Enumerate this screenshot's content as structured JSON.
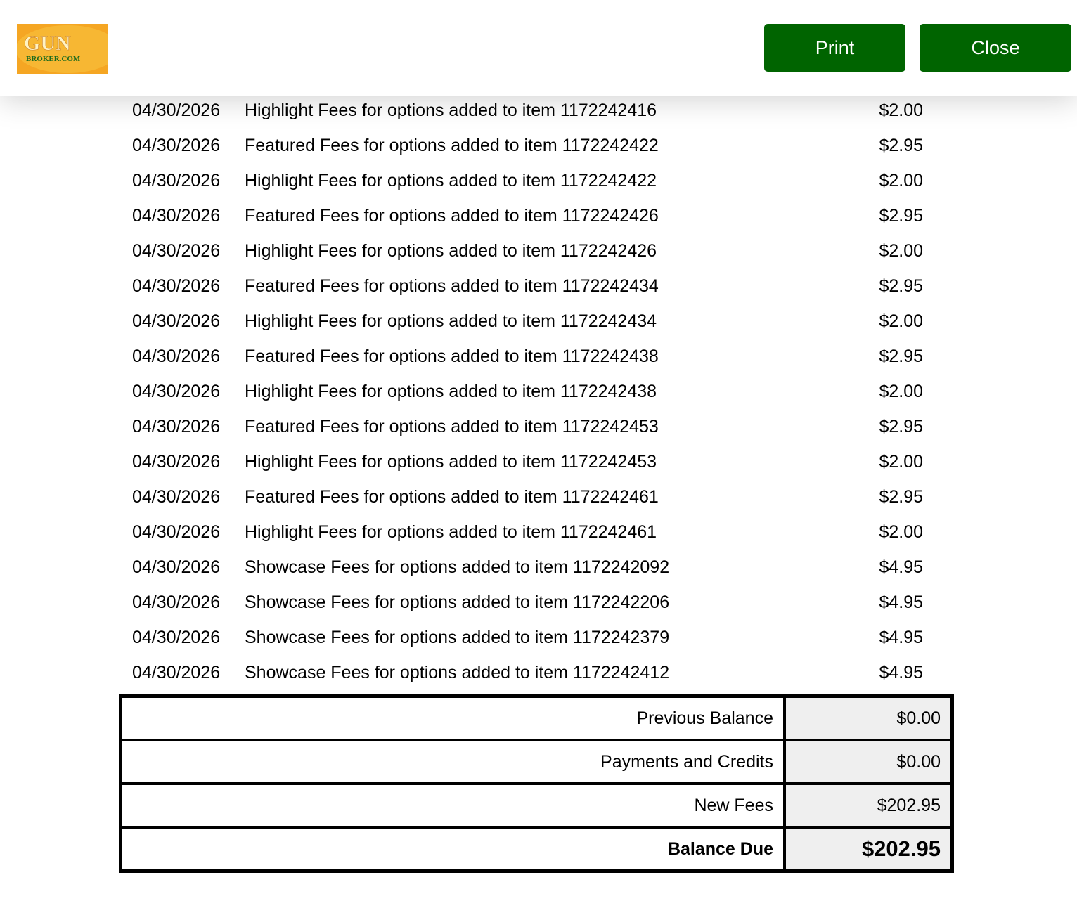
{
  "header": {
    "logo_text_top": "GUN",
    "logo_text_bottom": "BROKER.COM",
    "print_label": "Print",
    "close_label": "Close"
  },
  "colors": {
    "button_green": "#006400",
    "logo_orange": "#F5A623",
    "logo_green": "#1E6B1E",
    "summary_value_bg": "#EFEFEF"
  },
  "fees": [
    {
      "date": "04/30/2026",
      "description": "Highlight Fees for options added to item 1172242416",
      "amount": "$2.00"
    },
    {
      "date": "04/30/2026",
      "description": "Featured Fees for options added to item 1172242422",
      "amount": "$2.95"
    },
    {
      "date": "04/30/2026",
      "description": "Highlight Fees for options added to item 1172242422",
      "amount": "$2.00"
    },
    {
      "date": "04/30/2026",
      "description": "Featured Fees for options added to item 1172242426",
      "amount": "$2.95"
    },
    {
      "date": "04/30/2026",
      "description": "Highlight Fees for options added to item 1172242426",
      "amount": "$2.00"
    },
    {
      "date": "04/30/2026",
      "description": "Featured Fees for options added to item 1172242434",
      "amount": "$2.95"
    },
    {
      "date": "04/30/2026",
      "description": "Highlight Fees for options added to item 1172242434",
      "amount": "$2.00"
    },
    {
      "date": "04/30/2026",
      "description": "Featured Fees for options added to item 1172242438",
      "amount": "$2.95"
    },
    {
      "date": "04/30/2026",
      "description": "Highlight Fees for options added to item 1172242438",
      "amount": "$2.00"
    },
    {
      "date": "04/30/2026",
      "description": "Featured Fees for options added to item 1172242453",
      "amount": "$2.95"
    },
    {
      "date": "04/30/2026",
      "description": "Highlight Fees for options added to item 1172242453",
      "amount": "$2.00"
    },
    {
      "date": "04/30/2026",
      "description": "Featured Fees for options added to item 1172242461",
      "amount": "$2.95"
    },
    {
      "date": "04/30/2026",
      "description": "Highlight Fees for options added to item 1172242461",
      "amount": "$2.00"
    },
    {
      "date": "04/30/2026",
      "description": "Showcase Fees for options added to item 1172242092",
      "amount": "$4.95"
    },
    {
      "date": "04/30/2026",
      "description": "Showcase Fees for options added to item 1172242206",
      "amount": "$4.95"
    },
    {
      "date": "04/30/2026",
      "description": "Showcase Fees for options added to item 1172242379",
      "amount": "$4.95"
    },
    {
      "date": "04/30/2026",
      "description": "Showcase Fees for options added to item 1172242412",
      "amount": "$4.95"
    }
  ],
  "summary": {
    "previous_balance_label": "Previous Balance",
    "previous_balance_value": "$0.00",
    "payments_label": "Payments and Credits",
    "payments_value": "$0.00",
    "new_fees_label": "New Fees",
    "new_fees_value": "$202.95",
    "balance_due_label": "Balance Due",
    "balance_due_value": "$202.95"
  }
}
